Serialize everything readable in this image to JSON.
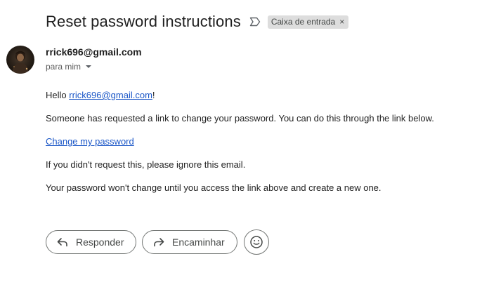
{
  "email": {
    "subject": "Reset password instructions",
    "label": "Caixa de entrada",
    "label_close": "×",
    "sender": "rrick696@gmail.com",
    "recipient": "para mim",
    "body": {
      "greeting_prefix": "Hello ",
      "greeting_link": "rrick696@gmail.com",
      "greeting_suffix": "!",
      "line1": "Someone has requested a link to change your password. You can do this through the link below.",
      "change_link": "Change my password",
      "line2": "If you didn't request this, please ignore this email.",
      "line3": "Your password won't change until you access the link above and create a new one."
    }
  },
  "actions": {
    "reply_label": "Responder",
    "forward_label": "Encaminhar"
  },
  "icons": {
    "important": "important-marker-icon",
    "caret": "chevron-down-icon",
    "reply": "reply-icon",
    "forward": "forward-icon",
    "emoji": "emoji-icon"
  },
  "colors": {
    "link": "#1a56c7",
    "chip": "#dddddd",
    "text": "#1f1f1f"
  }
}
